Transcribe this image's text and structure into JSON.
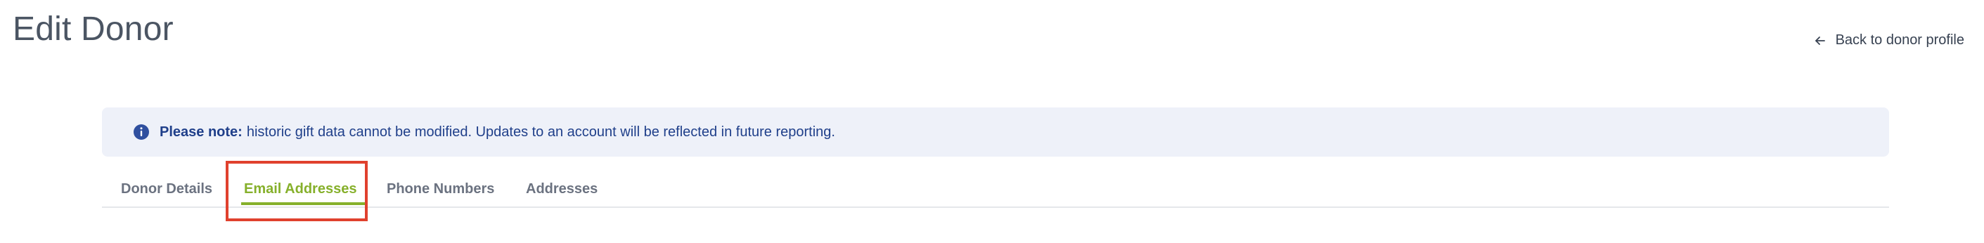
{
  "header": {
    "title": "Edit Donor",
    "back_link": {
      "label": "Back to donor profile",
      "icon": "arrow-left-icon"
    }
  },
  "notice": {
    "icon": "info-icon",
    "bold_label": "Please note:",
    "message": "historic gift data cannot be modified. Updates to an account will be reflected in future reporting."
  },
  "tabs": [
    {
      "label": "Donor Details",
      "active": false
    },
    {
      "label": "Email Addresses",
      "active": true
    },
    {
      "label": "Phone Numbers",
      "active": false
    },
    {
      "label": "Addresses",
      "active": false
    }
  ],
  "colors": {
    "accent": "#86b02b",
    "notice_bg": "#eef1f9",
    "notice_text": "#1f3f8a",
    "highlight": "#e0412e"
  }
}
